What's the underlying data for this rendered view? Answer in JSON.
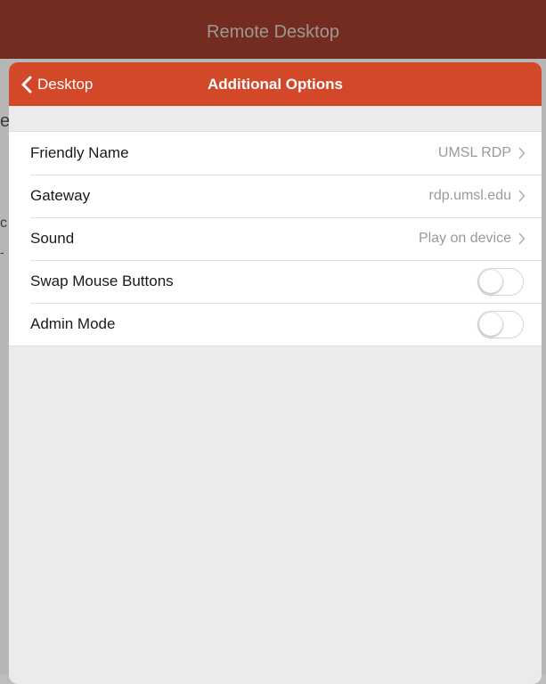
{
  "background_app": {
    "title": "Remote Desktop",
    "peek_glyphs": [
      "e",
      "c",
      "-"
    ]
  },
  "sheet": {
    "back_label": "Desktop",
    "title": "Additional Options",
    "rows": [
      {
        "label": "Friendly Name",
        "value": "UMSL RDP"
      },
      {
        "label": "Gateway",
        "value": "rdp.umsl.edu"
      },
      {
        "label": "Sound",
        "value": "Play on device"
      },
      {
        "label": "Swap Mouse Buttons",
        "toggle_on": false
      },
      {
        "label": "Admin Mode",
        "toggle_on": false
      }
    ]
  },
  "colors": {
    "nav_accent": "#d4482a",
    "background_header": "#742b20",
    "sheet_background": "#ebebeb"
  }
}
